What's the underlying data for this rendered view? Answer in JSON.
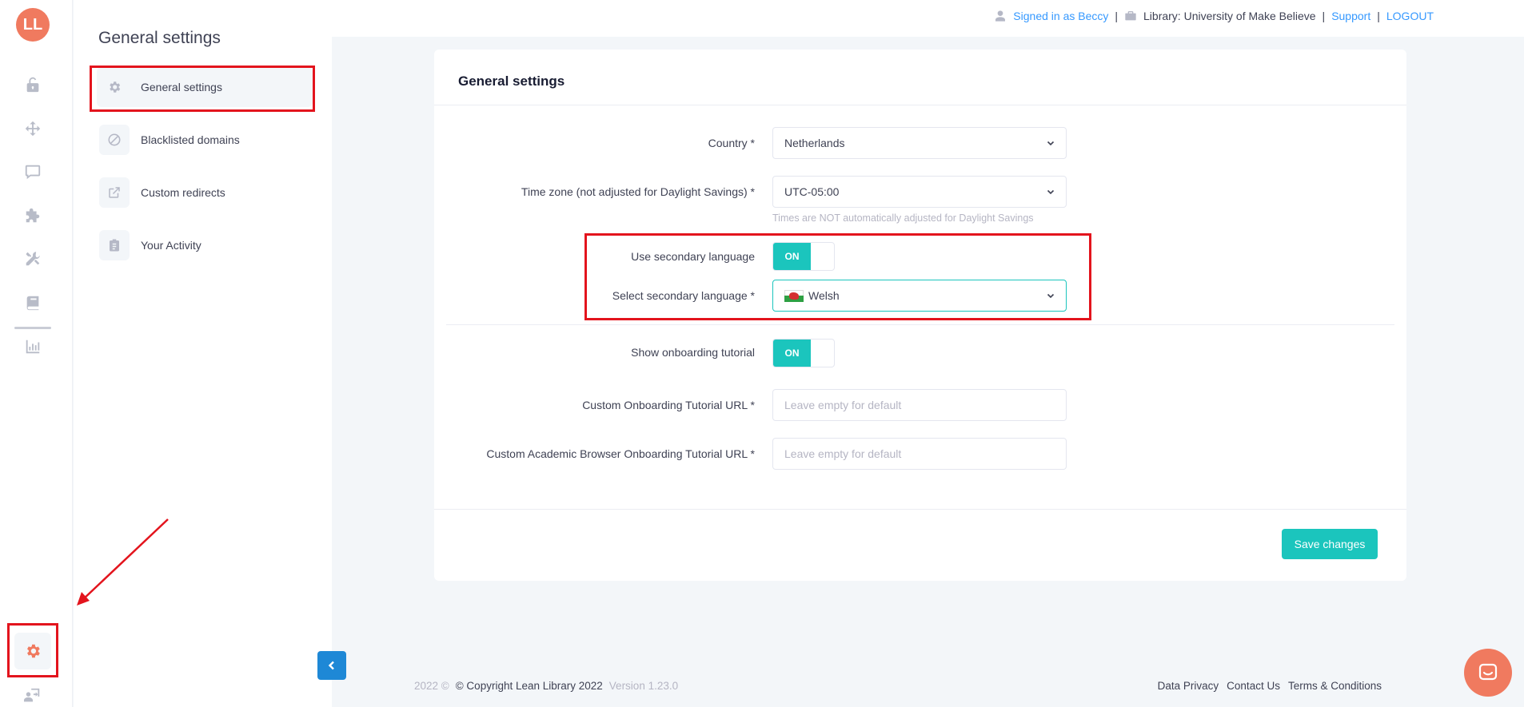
{
  "rail": {
    "logo_text": "LL",
    "icons": [
      "unlock-icon",
      "move-arrows-icon",
      "comment-icon",
      "puzzle-icon",
      "tools-icon",
      "books-icon",
      "bar-chart-icon"
    ],
    "settings_icon": "gear-icon",
    "bottom_icon": "user-switch-icon"
  },
  "subnav": {
    "title": "General settings",
    "items": [
      {
        "label": "General settings",
        "icon": "gear-icon",
        "active": true
      },
      {
        "label": "Blacklisted domains",
        "icon": "ban-icon"
      },
      {
        "label": "Custom redirects",
        "icon": "external-link-icon"
      },
      {
        "label": "Your Activity",
        "icon": "clipboard-icon"
      }
    ]
  },
  "topbar": {
    "signed_in": "Signed in as Beccy",
    "library": "Library: University of Make Believe",
    "support": "Support",
    "logout": "LOGOUT",
    "separator": "|"
  },
  "card": {
    "title": "General settings",
    "country": {
      "label": "Country *",
      "value": "Netherlands"
    },
    "timezone": {
      "label": "Time zone (not adjusted for Daylight Savings) *",
      "value": "UTC-05:00",
      "hint": "Times are NOT automatically adjusted for Daylight Savings"
    },
    "secondary_language": {
      "label": "Use secondary language",
      "toggle": "ON"
    },
    "select_language": {
      "label": "Select secondary language *",
      "value": "Welsh"
    },
    "onboarding": {
      "label": "Show onboarding tutorial",
      "toggle": "ON"
    },
    "onboarding_url": {
      "label": "Custom Onboarding Tutorial URL *",
      "placeholder": "Leave empty for default"
    },
    "academic_url": {
      "label": "Custom Academic Browser Onboarding Tutorial URL *",
      "placeholder": "Leave empty for default"
    },
    "save_label": "Save changes"
  },
  "footer": {
    "year": "2022 ©",
    "copyright": "© Copyright Lean Library 2022",
    "version": "Version 1.23.0",
    "links": [
      "Data Privacy",
      "Contact Us",
      "Terms & Conditions"
    ]
  },
  "colors": {
    "accent": "#1bc5bd",
    "brand": "#f07a5f",
    "link": "#3699ff",
    "annotation": "#e3141d"
  }
}
